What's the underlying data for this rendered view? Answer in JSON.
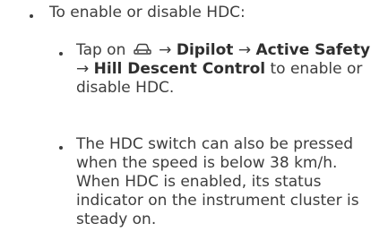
{
  "list": {
    "item1": {
      "text": "To enable or disable HDC:"
    },
    "item2": {
      "prefix": "Tap on",
      "icon": "car-icon",
      "arrow1": "→",
      "dipilot": "Dipilot",
      "arrow2": "→",
      "active_safety": "Active Safety",
      "arrow3": "→",
      "hdc_name": "Hill Descent Control",
      "suffix": "to enable or disable HDC."
    },
    "item3": {
      "text": "The HDC switch can also be pressed when the speed is below 38 km/h. When HDC is enabled, its status indicator on the instrument cluster is steady on."
    }
  },
  "colors": {
    "text": "#3d3d3d"
  }
}
